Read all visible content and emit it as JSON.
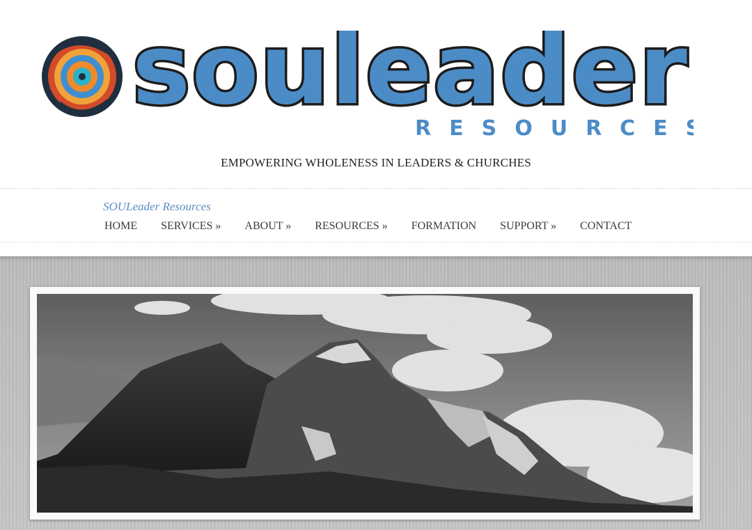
{
  "header": {
    "logo_wordmark": "souleader",
    "logo_subword": "RESOURCES",
    "tagline": "EMPOWERING WHOLENESS IN LEADERS & CHURCHES",
    "logo_icon": "swirl-logo-icon"
  },
  "nav": {
    "site_title": "SOULeader Resources",
    "items": [
      {
        "label": "HOME"
      },
      {
        "label": "SERVICES »"
      },
      {
        "label": "ABOUT »"
      },
      {
        "label": "RESOURCES »"
      },
      {
        "label": "FORMATION"
      },
      {
        "label": "SUPPORT »"
      },
      {
        "label": "CONTACT"
      }
    ]
  },
  "banner": {
    "image": "black-and-white mountain landscape photo"
  },
  "colors": {
    "brand_blue": "#4c8cc6",
    "title_blue": "#5b8fc4",
    "banner_gray": "#c2c2c2"
  }
}
